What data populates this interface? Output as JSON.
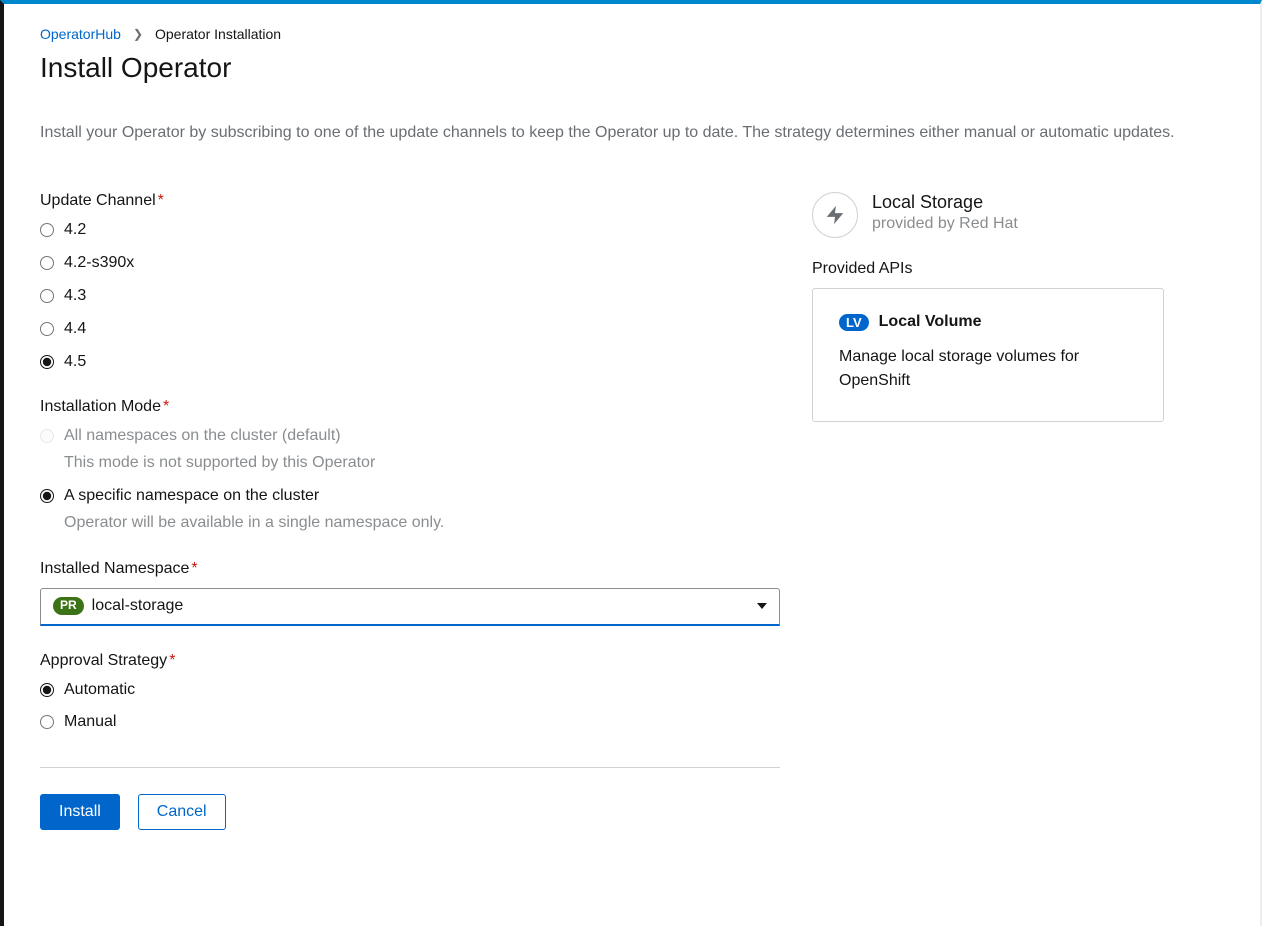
{
  "breadcrumb": {
    "link": "OperatorHub",
    "current": "Operator Installation"
  },
  "page_title": "Install Operator",
  "description": "Install your Operator by subscribing to one of the update channels to keep the Operator up to date. The strategy determines either manual or automatic updates.",
  "update_channel": {
    "label": "Update Channel",
    "options": [
      "4.2",
      "4.2-s390x",
      "4.3",
      "4.4",
      "4.5"
    ],
    "selected": "4.5"
  },
  "installation_mode": {
    "label": "Installation Mode",
    "options": [
      {
        "label": "All namespaces on the cluster (default)",
        "sublabel": "This mode is not supported by this Operator",
        "disabled": true
      },
      {
        "label": "A specific namespace on the cluster",
        "sublabel": "Operator will be available in a single namespace only.",
        "selected": true
      }
    ]
  },
  "installed_namespace": {
    "label": "Installed Namespace",
    "badge": "PR",
    "value": "local-storage"
  },
  "approval_strategy": {
    "label": "Approval Strategy",
    "options": [
      "Automatic",
      "Manual"
    ],
    "selected": "Automatic"
  },
  "buttons": {
    "install": "Install",
    "cancel": "Cancel"
  },
  "sidebar": {
    "operator_name": "Local Storage",
    "provider": "provided by Red Hat",
    "apis_label": "Provided APIs",
    "api": {
      "badge": "LV",
      "title": "Local Volume",
      "description": "Manage local storage volumes for OpenShift"
    }
  }
}
